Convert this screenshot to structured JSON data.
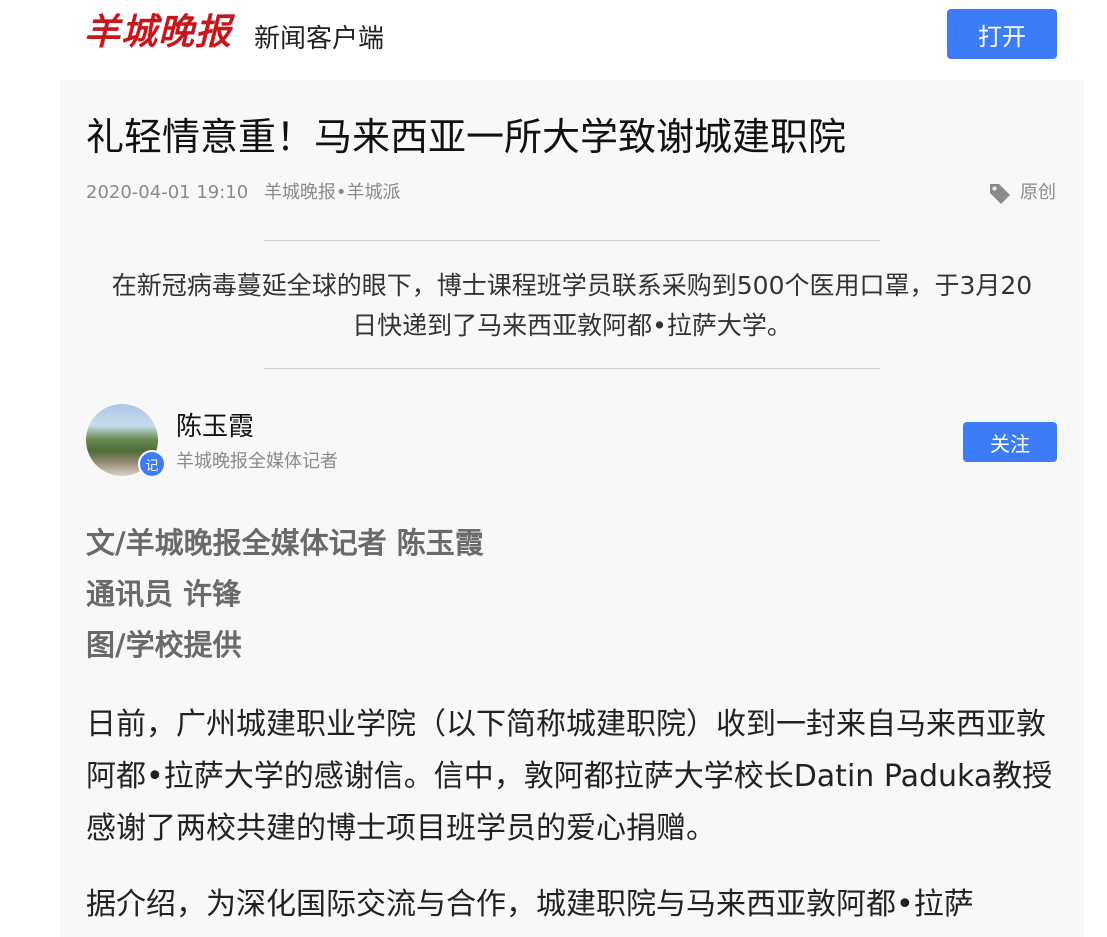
{
  "header": {
    "logo_text": "羊城晚报",
    "app_name": "新闻客户端",
    "open_button": "打开"
  },
  "article": {
    "title": "礼轻情意重！马来西亚一所大学致谢城建职院",
    "date": "2020-04-01 19:10",
    "source": "羊城晚报•羊城派",
    "tag_label": "原创",
    "summary": "在新冠病毒蔓延全球的眼下，博士课程班学员联系采购到500个医用口罩，于3月20日快递到了马来西亚敦阿都•拉萨大学。",
    "author": {
      "name": "陈玉霞",
      "role": "羊城晚报全媒体记者",
      "badge": "记",
      "follow_button": "关注"
    },
    "credits": [
      "文/羊城晚报全媒体记者 陈玉霞",
      "通讯员 许锋",
      "图/学校提供"
    ],
    "paragraphs": [
      "日前，广州城建职业学院（以下简称城建职院）收到一封来自马来西亚敦阿都•拉萨大学的感谢信。信中，敦阿都拉萨大学校长Datin Paduka教授感谢了两校共建的博士项目班学员的爱心捐赠。",
      "据介绍，为深化国际交流与合作，城建职院与马来西亚敦阿都•拉萨"
    ]
  },
  "colors": {
    "brand_red": "#c8161d",
    "accent_blue": "#3d7cf7"
  }
}
